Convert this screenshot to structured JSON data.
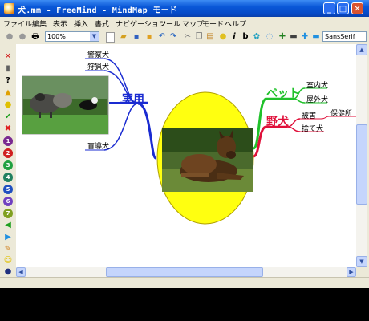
{
  "window": {
    "title": "犬.mm - FreeMind - MindMap モード"
  },
  "menu": [
    "ファイル",
    "編集",
    "表示",
    "挿入",
    "書式",
    "ナビゲーション",
    "ツール",
    "マップ",
    "モード",
    "ヘルプ"
  ],
  "toolbar": {
    "zoom": "100%",
    "font": "SansSerif"
  },
  "mindmap": {
    "center_label": "犬",
    "branch_practical": "実用",
    "practical_children": [
      "警察犬",
      "狩猟犬",
      "盲導犬"
    ],
    "branch_pet": "ペット",
    "pet_children": [
      "室内犬",
      "屋外犬"
    ],
    "branch_wild": "野犬",
    "wild_children": [
      "被害",
      "捨て犬"
    ],
    "wild_grandchild": "保健所"
  },
  "colors": {
    "practical": "#1a2bd1",
    "pet": "#1fc12a",
    "wild": "#e0103a",
    "center_fill": "#ffff10"
  }
}
